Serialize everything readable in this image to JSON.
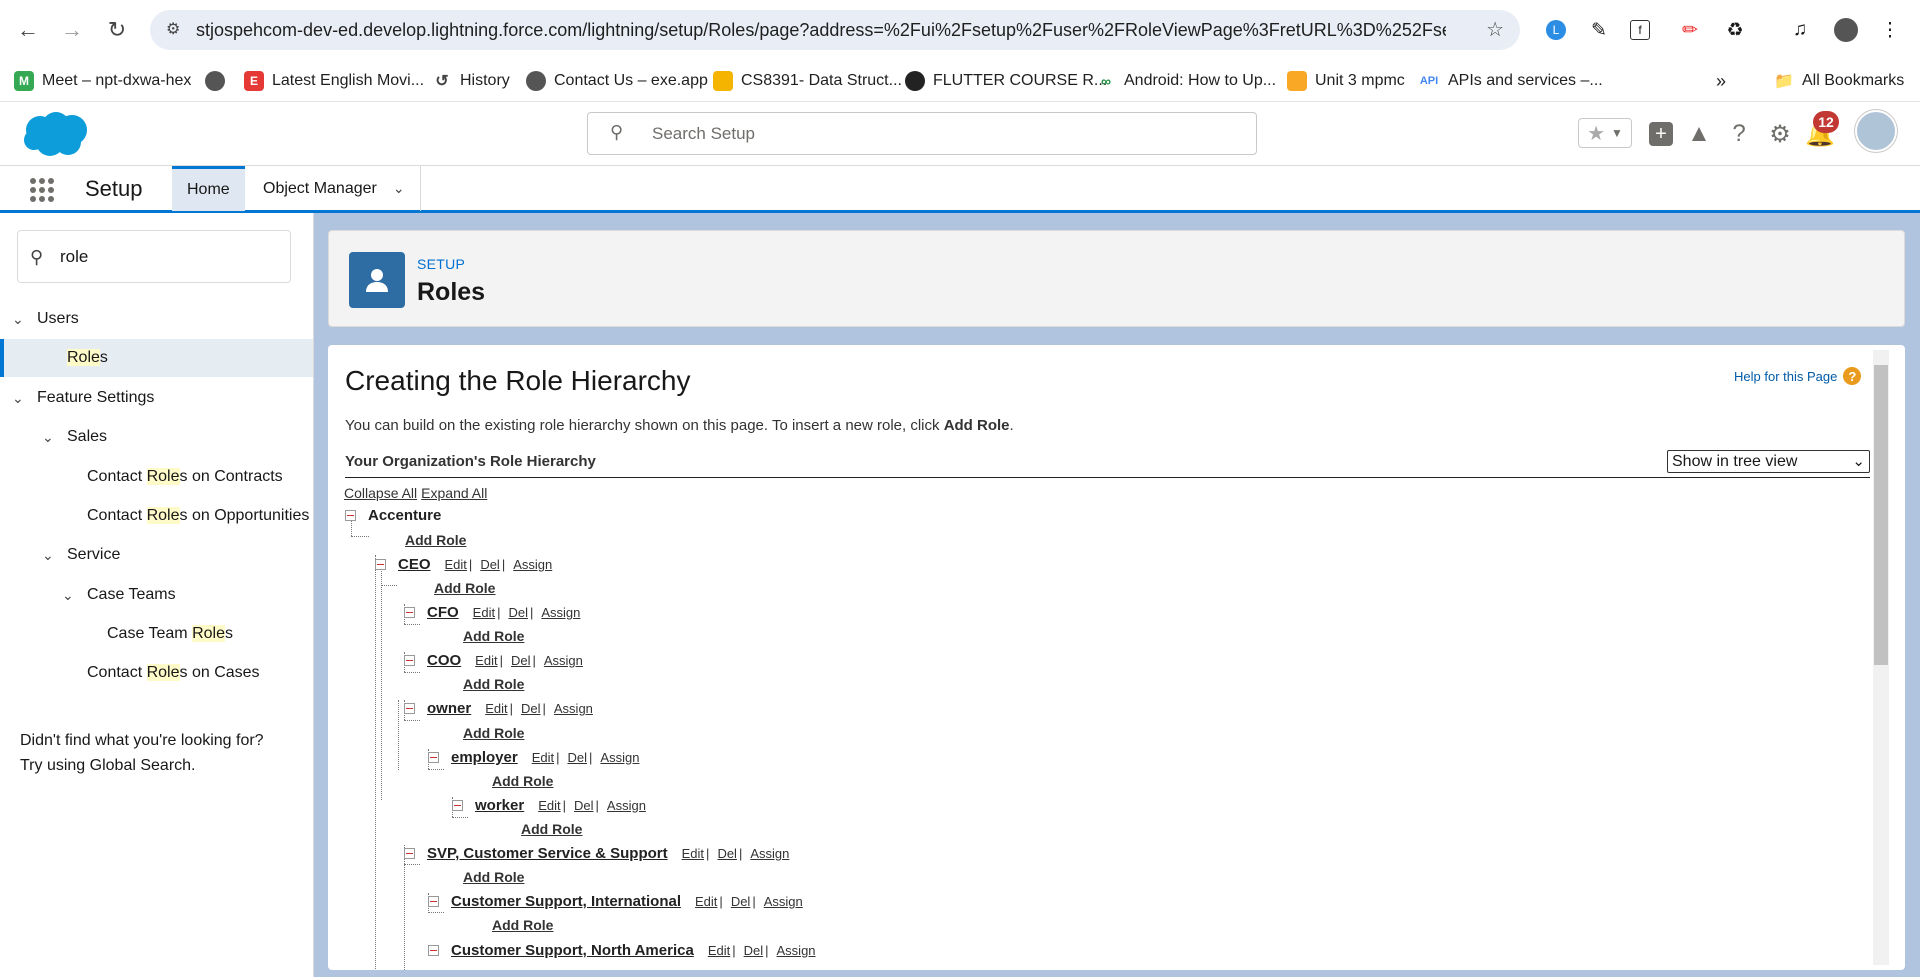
{
  "browser": {
    "url": "stjospehcom-dev-ed.develop.lightning.force.com/lightning/setup/Roles/page?address=%2Fui%2Fsetup%2Fuser%2FRoleViewPage%3FretURL%3D%252Fsetup%252...",
    "bookmarks": [
      "Meet – npt-dxwa-hex",
      "Latest English Movi...",
      "History",
      "Contact Us – exe.app",
      "CS8391- Data Struct...",
      "FLUTTER COURSE R...",
      "Android: How to Up...",
      "Unit 3 mpmc",
      "APIs and services –...",
      "All Bookmarks"
    ]
  },
  "header": {
    "search_placeholder": "Search Setup",
    "notification_count": "12"
  },
  "nav": {
    "app_name": "Setup",
    "tabs": [
      "Home",
      "Object Manager"
    ]
  },
  "sidebar": {
    "quick_find": "role",
    "items": [
      {
        "label_pre": "",
        "hl": "",
        "label_post": "Users"
      },
      {
        "label_pre": "",
        "hl": "Role",
        "label_post": "s"
      },
      {
        "label_pre": "",
        "hl": "",
        "label_post": "Feature Settings"
      },
      {
        "label_pre": "",
        "hl": "",
        "label_post": "Sales"
      },
      {
        "label_pre": "Contact ",
        "hl": "Role",
        "label_post": "s on Contracts"
      },
      {
        "label_pre": "Contact ",
        "hl": "Role",
        "label_post": "s on Opportunities"
      },
      {
        "label_pre": "",
        "hl": "",
        "label_post": "Service"
      },
      {
        "label_pre": "",
        "hl": "",
        "label_post": "Case Teams"
      },
      {
        "label_pre": "Case Team ",
        "hl": "Role",
        "label_post": "s"
      },
      {
        "label_pre": "Contact ",
        "hl": "Role",
        "label_post": "s on Cases"
      }
    ],
    "not_found_1": "Didn't find what you're looking for?",
    "not_found_2": "Try using Global Search."
  },
  "page_header": {
    "eyebrow": "SETUP",
    "title": "Roles"
  },
  "main": {
    "title": "Creating the Role Hierarchy",
    "help": "Help for this Page",
    "desc_pre": "You can build on the existing role hierarchy shown on this page. To insert a new role, click ",
    "desc_bold": "Add Role",
    "desc_post": ".",
    "hierarchy_title": "Your Organization's Role Hierarchy",
    "view_option": "Show in tree view",
    "collapse_all": "Collapse All",
    "expand_all": "Expand All",
    "root": "Accenture",
    "add_role": "Add Role",
    "edit": "Edit",
    "del": "Del",
    "assign": "Assign",
    "roles": [
      "CEO",
      "CFO",
      "COO",
      "owner",
      "employer",
      "worker",
      "SVP, Customer Service & Support",
      "Customer Support, International",
      "Customer Support, North America"
    ]
  }
}
